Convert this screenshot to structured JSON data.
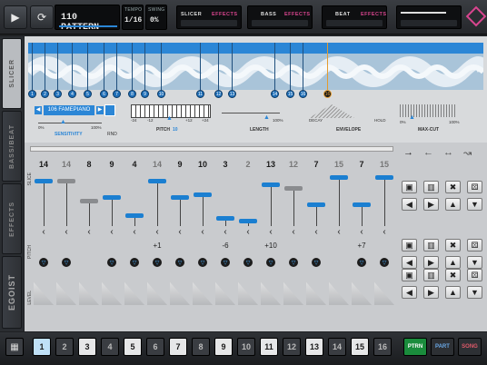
{
  "header": {
    "pattern_name": "110 PATTERN",
    "tempo_label": "TEMPO",
    "tempo_value": "1/16",
    "swing_label": "SWING",
    "swing_value": "0%"
  },
  "modules": [
    {
      "name": "SLICER",
      "effects": "EFFECTS"
    },
    {
      "name": "BASS",
      "effects": "EFFECTS"
    },
    {
      "name": "BEAT",
      "effects": "EFFECTS"
    }
  ],
  "side_tabs": [
    "SLICER",
    "BASS/BEAT",
    "EFFECTS",
    "EGOIST"
  ],
  "slicer": {
    "markers": [
      "1",
      "2",
      "3",
      "4",
      "5",
      "6",
      "7",
      "8",
      "9",
      "10",
      "11",
      "12",
      "13",
      "14",
      "15",
      "16"
    ],
    "selected_marker": "16",
    "sample_name": "106 FAMEPIANO",
    "sensitivity_label": "SENSITIVITY",
    "sens_min": "0%",
    "sens_max": "100%",
    "rnd_label": "RND",
    "pitch_label": "PITCH",
    "pitch_value": "10",
    "pitch_ticks": [
      "-24",
      "-12",
      "+12",
      "+24"
    ],
    "length_label": "LENGTH",
    "length_max": "100%",
    "envelope_label": "ENVELOPE",
    "decay_label": "DECAY",
    "hold_label": "HOLD",
    "maxcut_label": "MAX-CUT",
    "maxcut_min": "0%",
    "maxcut_max": "100%"
  },
  "sequencer": {
    "steps": [
      "14",
      "14",
      "8",
      "9",
      "4",
      "14",
      "9",
      "10",
      "3",
      "2",
      "13",
      "12",
      "7",
      "15",
      "7",
      "15"
    ],
    "pitch": [
      "",
      "",
      "",
      "",
      "",
      "+1",
      "",
      "",
      "-6",
      "",
      "+10",
      "",
      "",
      "",
      "+7",
      ""
    ],
    "row_labels": [
      "LEVEL",
      "PITCH",
      "LEVEL"
    ],
    "slice_label": "SLICE"
  },
  "bottom": {
    "patterns": [
      "1",
      "2",
      "3",
      "4",
      "5",
      "6",
      "7",
      "8",
      "9",
      "10",
      "11",
      "12",
      "13",
      "14",
      "15",
      "16"
    ],
    "selected": "1",
    "ptrn": "PTRN",
    "part": "PART",
    "song": "SONG"
  },
  "colors": {
    "accent": "#2b86d6",
    "marker_active": "#e39b2f",
    "bar_blue": "#1b7fd1",
    "ptrn": "#1a8c3c",
    "song": "#a3273a"
  }
}
